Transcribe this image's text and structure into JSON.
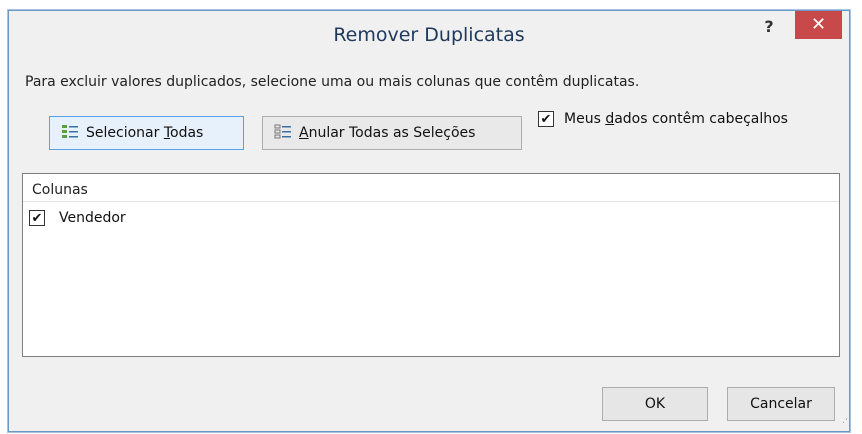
{
  "window": {
    "title": "Remover Duplicatas",
    "help_label": "?",
    "close_label": "✕"
  },
  "instructions": "Para excluir valores duplicados, selecione uma ou mais colunas que contêm duplicatas.",
  "buttons": {
    "select_all": {
      "prefix": "Selecionar ",
      "accel": "T",
      "suffix": "odas",
      "icon": "select-all-icon"
    },
    "unselect_all": {
      "prefix": "",
      "accel": "A",
      "suffix": "nular Todas as Seleções",
      "icon": "unselect-all-icon"
    }
  },
  "header_checkbox": {
    "checked": true,
    "prefix": "Meus ",
    "accel": "d",
    "suffix": "ados contêm cabeçalhos"
  },
  "columns_list": {
    "header": "Colunas",
    "items": [
      {
        "label": "Vendedor",
        "checked": true
      }
    ]
  },
  "footer": {
    "ok_label": "OK",
    "cancel_label": "Cancelar"
  },
  "colors": {
    "close_bg": "#c7494a",
    "title_text": "#1e395b",
    "selected_border": "#5aa0e6"
  }
}
